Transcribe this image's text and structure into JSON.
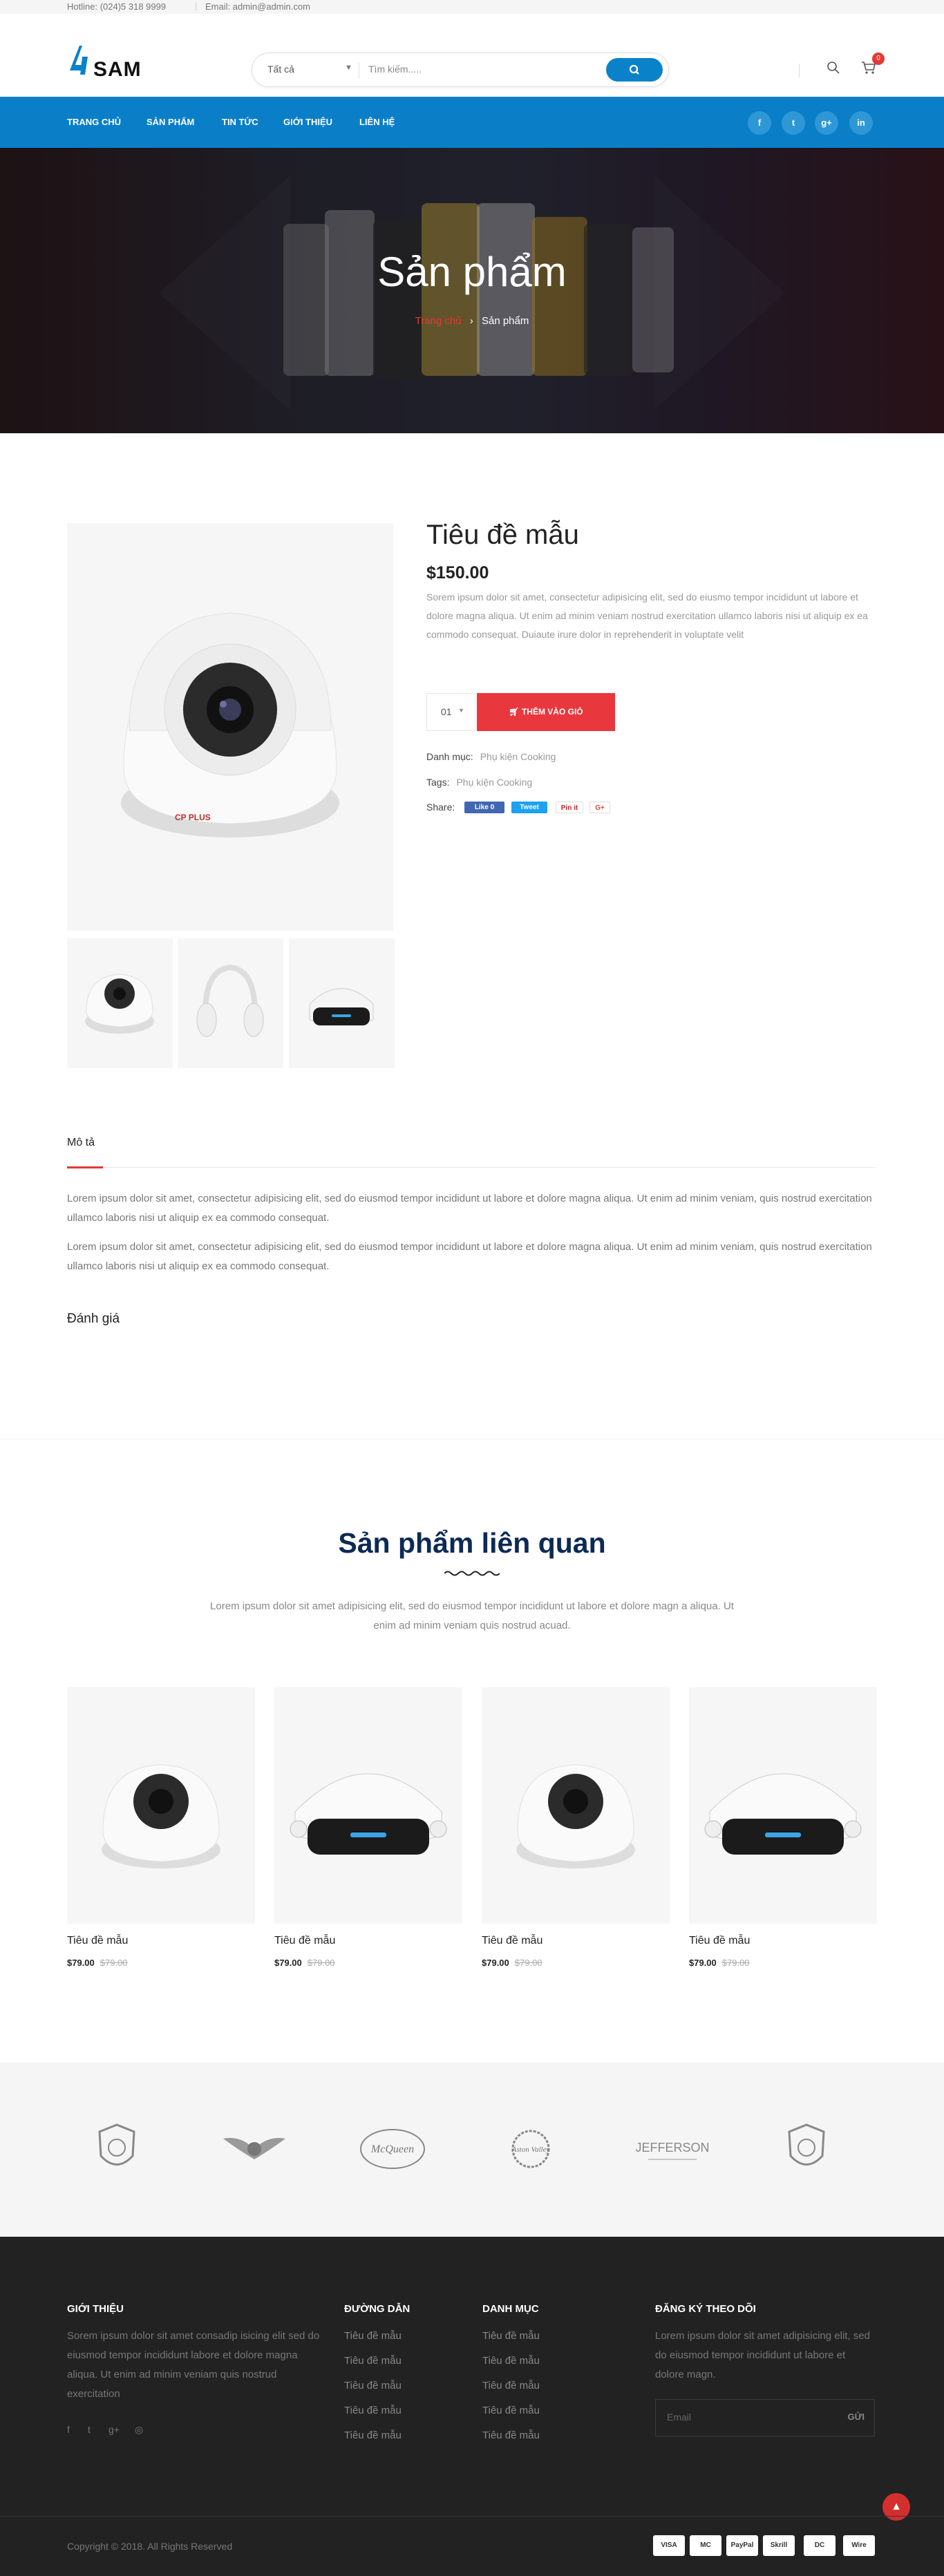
{
  "topbar": {
    "hotline": "Hotline: (024)5 318 9999",
    "email": "Email: admin@admin.com"
  },
  "header": {
    "logo_text": "SAM",
    "search_category": "Tất cả",
    "search_placeholder": "Tìm kiếm.....",
    "cart_count": "0"
  },
  "nav": {
    "items": [
      "TRANG CHỦ",
      "SẢN PHẨM",
      "TIN TỨC",
      "GIỚI THIỆU",
      "LIÊN HỆ"
    ]
  },
  "social": [
    "f",
    "t",
    "g+",
    "in"
  ],
  "banner": {
    "title": "Sản phẩm",
    "crumb_home": "Trang chủ",
    "crumb_current": "Sản phẩm"
  },
  "product": {
    "title": "Tiêu đề mẫu",
    "price": "$150.00",
    "description": "Sorem ipsum dolor sit amet, consectetur adipisicing elit, sed do eiusmo tempor incididunt ut labore et dolore magna aliqua. Ut enim ad minim veniam nostrud exercitation ullamco laboris nisi ut aliquip ex ea commodo consequat. Duiaute irure dolor in reprehenderit in voluptate velit",
    "qty": "01",
    "add_to_cart": "THÊM VÀO GIỎ",
    "category_label": "Danh mục:",
    "category_value": "Phụ kiện Cooking",
    "tags_label": "Tags:",
    "tags_value": "Phụ kiện Cooking",
    "share_label": "Share:",
    "share_buttons": [
      "Like 0",
      "Tweet",
      "Pin it",
      "G+"
    ]
  },
  "tabs": {
    "description_title": "Mô tả",
    "paragraph1": "Lorem ipsum dolor sit amet, consectetur adipisicing elit, sed do eiusmod tempor incididunt ut labore et dolore magna aliqua. Ut enim ad minim veniam, quis nostrud exercitation ullamco laboris nisi ut aliquip ex ea commodo consequat.",
    "paragraph2": "Lorem ipsum dolor sit amet, consectetur adipisicing elit, sed do eiusmod tempor incididunt ut labore et dolore magna aliqua. Ut enim ad minim veniam, quis nostrud exercitation ullamco laboris nisi ut aliquip ex ea commodo consequat.",
    "review_title": "Đánh giá"
  },
  "related": {
    "title": "Sản phẩm liên quan",
    "description": "Lorem ipsum dolor sit amet adipisicing elit, sed do eiusmod tempor incididunt ut labore et dolore magn a aliqua. Ut enim ad minim veniam quis nostrud acuad.",
    "items": [
      {
        "name": "Tiêu đề mẫu",
        "price": "$79.00",
        "old_price": "$79.00",
        "image": "camera"
      },
      {
        "name": "Tiêu đề mẫu",
        "price": "$79.00",
        "old_price": "$79.00",
        "image": "vr-headset"
      },
      {
        "name": "Tiêu đề mẫu",
        "price": "$79.00",
        "old_price": "$79.00",
        "image": "camera"
      },
      {
        "name": "Tiêu đề mẫu",
        "price": "$79.00",
        "old_price": "$79.00",
        "image": "vr-headset"
      }
    ]
  },
  "brands": {
    "names": [
      "McQueen",
      "Aston Valley",
      "JEFFERSON"
    ]
  },
  "footer": {
    "about_title": "GIỚI THIỆU",
    "about_text": "Sorem ipsum dolor sit amet consadip isicing elit sed do eiusmod tempor incididunt labore et dolore magna aliqua. Ut enim ad minim veniam quis nostrud exercitation",
    "links_title": "ĐƯỜNG DẪN",
    "links": [
      "Tiêu đề mẫu",
      "Tiêu đề mẫu",
      "Tiêu đề mẫu",
      "Tiêu đề mẫu",
      "Tiêu đề mẫu"
    ],
    "categories_title": "DANH MỤC",
    "categories": [
      "Tiêu đề mẫu",
      "Tiêu đề mẫu",
      "Tiêu đề mẫu",
      "Tiêu đề mẫu",
      "Tiêu đề mẫu"
    ],
    "subscribe_title": "ĐĂNG KÝ THEO DÕI",
    "subscribe_text": "Lorem ipsum dolor sit amet adipisicing elit, sed do eiusmod tempor incididunt ut labore et dolore magn.",
    "email_placeholder": "Email",
    "subscribe_button": "GỬI",
    "copyright": "Copyright © 2018. All Rights Reserved",
    "payments": [
      "VISA",
      "MC",
      "PayPal",
      "Skrill",
      "DC",
      "Wire"
    ]
  },
  "colors": {
    "primary": "#0a7fc8",
    "accent": "#e9373e",
    "footer_bg": "#222222"
  }
}
